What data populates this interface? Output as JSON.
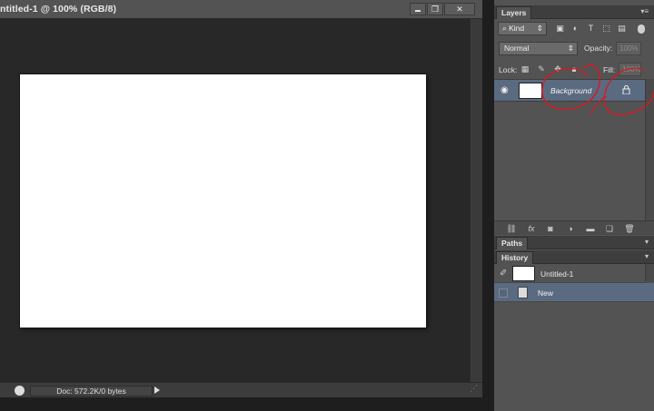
{
  "document": {
    "title": "ntitled-1 @ 100% (RGB/8)",
    "status_doc": "Doc: 572.2K/0 bytes",
    "window_buttons": {
      "minimize": "▬",
      "restore": "❐",
      "close": "✕"
    }
  },
  "layers_panel": {
    "tab_label": "Layers",
    "filter_kind": "Kind",
    "blend_mode": "Normal",
    "opacity_label": "Opacity:",
    "opacity_value": "100%",
    "lock_label": "Lock:",
    "fill_label": "Fill:",
    "fill_value": "100%",
    "layers": [
      {
        "name": "Background",
        "visible": true,
        "locked": true
      }
    ]
  },
  "paths_panel": {
    "tab_label": "Paths"
  },
  "history_panel": {
    "tab_label": "History",
    "items": [
      {
        "label": "Untitled-1"
      },
      {
        "label": "New",
        "selected": true
      }
    ]
  },
  "icons": {
    "eye": "eye-icon",
    "lock": "lock-icon",
    "menu": "panel-menu-icon"
  },
  "colors": {
    "selection": "#5a6a80",
    "annotation": "#e0141e"
  }
}
